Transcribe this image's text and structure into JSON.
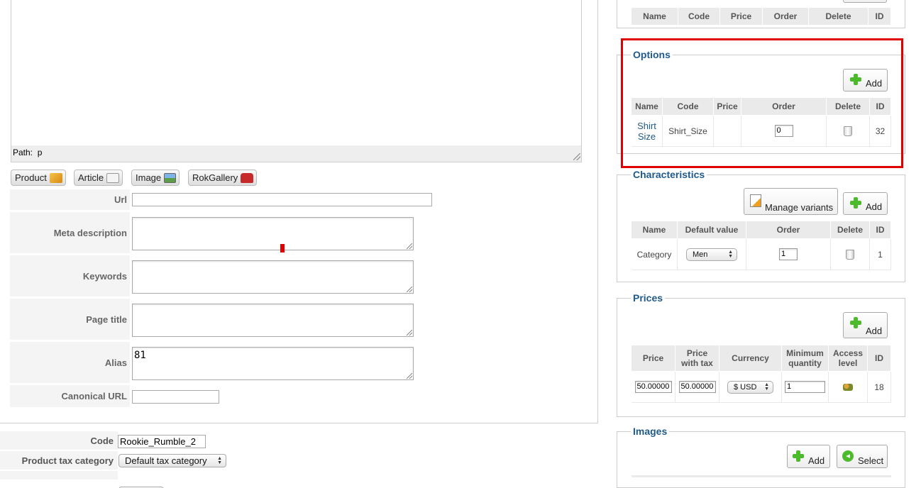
{
  "editor": {
    "path_label": "Path:",
    "path_value": "p"
  },
  "editor_buttons": [
    {
      "label": "Product",
      "icon": "box-icon"
    },
    {
      "label": "Article",
      "icon": "article-icon"
    },
    {
      "label": "Image",
      "icon": "image-icon"
    },
    {
      "label": "RokGallery",
      "icon": "gallery-icon"
    }
  ],
  "meta_fields": {
    "url_label": "Url",
    "url_value": "",
    "meta_description_label": "Meta description",
    "keywords_label": "Keywords",
    "page_title_label": "Page title",
    "alias_label": "Alias",
    "alias_value": "81",
    "canonical_label": "Canonical URL",
    "canonical_value": ""
  },
  "product_fields": {
    "code_label": "Code",
    "code_value": "Rookie_Rumble_2",
    "tax_label": "Product tax category",
    "tax_value": "Default tax category"
  },
  "top_table": {
    "headers": [
      "Name",
      "Code",
      "Price",
      "Order",
      "Delete",
      "ID"
    ]
  },
  "options": {
    "legend": "Options",
    "add_label": "Add",
    "headers": [
      "Name",
      "Code",
      "Price",
      "Order",
      "Delete",
      "ID"
    ],
    "row": {
      "name_line1": "Shirt",
      "name_line2": "Size",
      "code": "Shirt_Size",
      "price": "",
      "order": "0",
      "id": "32"
    }
  },
  "characteristics": {
    "legend": "Characteristics",
    "manage_label": "Manage variants",
    "add_label": "Add",
    "headers": [
      "Name",
      "Default value",
      "Order",
      "Delete",
      "ID"
    ],
    "row": {
      "name": "Category",
      "default_value": "Men",
      "order": "1",
      "id": "1"
    }
  },
  "prices": {
    "legend": "Prices",
    "add_label": "Add",
    "headers": [
      {
        "l1": "Price",
        "l2": ""
      },
      {
        "l1": "Price",
        "l2": "with tax"
      },
      {
        "l1": "Currency",
        "l2": ""
      },
      {
        "l1": "Minimum",
        "l2": "quantity"
      },
      {
        "l1": "Access",
        "l2": "level"
      },
      {
        "l1": "ID",
        "l2": ""
      }
    ],
    "row": {
      "price": "50.00000",
      "price_tax": "50.00000",
      "currency": "$ USD",
      "min_qty": "1",
      "id": "18"
    }
  },
  "images": {
    "legend": "Images",
    "add_label": "Add",
    "select_label": "Select"
  },
  "colors": {
    "highlight": "#e00000",
    "legend": "#1f5a8c",
    "plus": "#4bbb2c",
    "link": "#1f5a8c"
  }
}
